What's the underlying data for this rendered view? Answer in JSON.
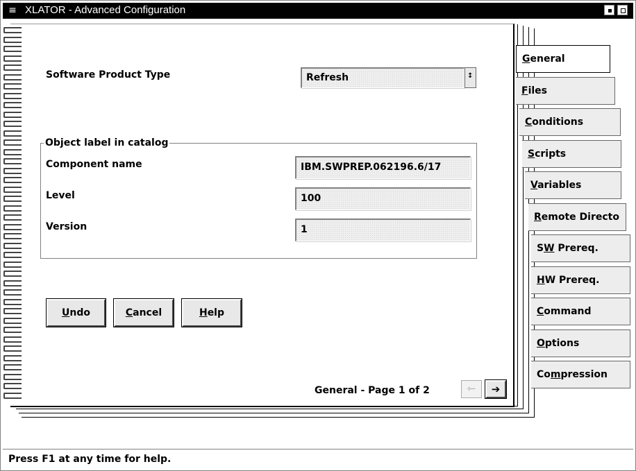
{
  "window": {
    "title": "XLATOR - Advanced Configuration",
    "system_menu_glyph": "≡"
  },
  "general": {
    "product_type_label": "Software Product Type",
    "product_type_value": "Refresh",
    "group_label": "Object label in catalog",
    "component_label": "Component name",
    "component_value": "IBM.SWPREP.062196.6/17",
    "level_label": "Level",
    "level_value": "100",
    "version_label": "Version",
    "version_value": "1"
  },
  "buttons": {
    "undo": {
      "mnemonic": "U",
      "rest": "ndo"
    },
    "cancel": {
      "mnemonic": "C",
      "rest": "ancel"
    },
    "help": {
      "mnemonic": "H",
      "rest": "elp"
    }
  },
  "pager": {
    "text": "General - Page 1 of 2",
    "prev_glyph": "⇽",
    "next_glyph": "➔"
  },
  "tabs": [
    {
      "pre": "",
      "mn": "G",
      "post": "eneral"
    },
    {
      "pre": "",
      "mn": "F",
      "post": "iles"
    },
    {
      "pre": "",
      "mn": "C",
      "post": "onditions"
    },
    {
      "pre": "",
      "mn": "S",
      "post": "cripts"
    },
    {
      "pre": "",
      "mn": "V",
      "post": "ariables"
    },
    {
      "pre": "",
      "mn": "R",
      "post": "emote Directo"
    },
    {
      "pre": "S",
      "mn": "W",
      "post": " Prereq."
    },
    {
      "pre": "",
      "mn": "H",
      "post": "W Prereq."
    },
    {
      "pre": "",
      "mn": "C",
      "post": "ommand"
    },
    {
      "pre": "",
      "mn": "O",
      "post": "ptions"
    },
    {
      "pre": "Co",
      "mn": "m",
      "post": "pression"
    }
  ],
  "status": {
    "text": "Press F1 at any time for help."
  }
}
